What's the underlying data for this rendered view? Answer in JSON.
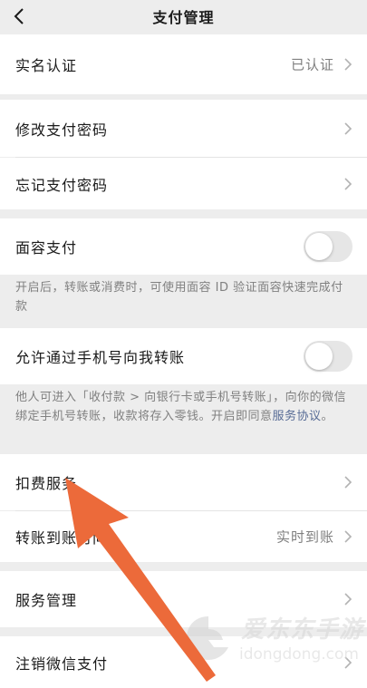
{
  "nav": {
    "title": "支付管理",
    "back_icon": "chevron-left-icon"
  },
  "rows": {
    "real_name": {
      "label": "实名认证",
      "value": "已认证"
    },
    "change_password": {
      "label": "修改支付密码"
    },
    "forgot_password": {
      "label": "忘记支付密码"
    },
    "face_pay": {
      "label": "面容支付",
      "enabled": false,
      "note": "开启后，转账或消费时，可使用面容 ID 验证面容快速完成付款"
    },
    "phone_transfer": {
      "label": "允许通过手机号向我转账",
      "enabled": false,
      "note_text": "他人可进入「收付款 > 向银行卡或手机号转账」，向你的微信绑定手机号转账，收款将存入零钱。开启即同意",
      "note_link": "服务协议",
      "note_end": "。"
    },
    "deduction": {
      "label": "扣费服务"
    },
    "transfer_arrival": {
      "label": "转账到账时间",
      "value": "实时到账"
    },
    "service_mgmt": {
      "label": "服务管理"
    },
    "cancel_pay": {
      "label": "注销微信支付"
    }
  },
  "watermark": {
    "cn": "爱东东手游",
    "en": "idongdong.com"
  },
  "colors": {
    "background": "#ededed",
    "cell": "#ffffff",
    "link": "#576b95",
    "arrow": "#ec6a3a"
  }
}
